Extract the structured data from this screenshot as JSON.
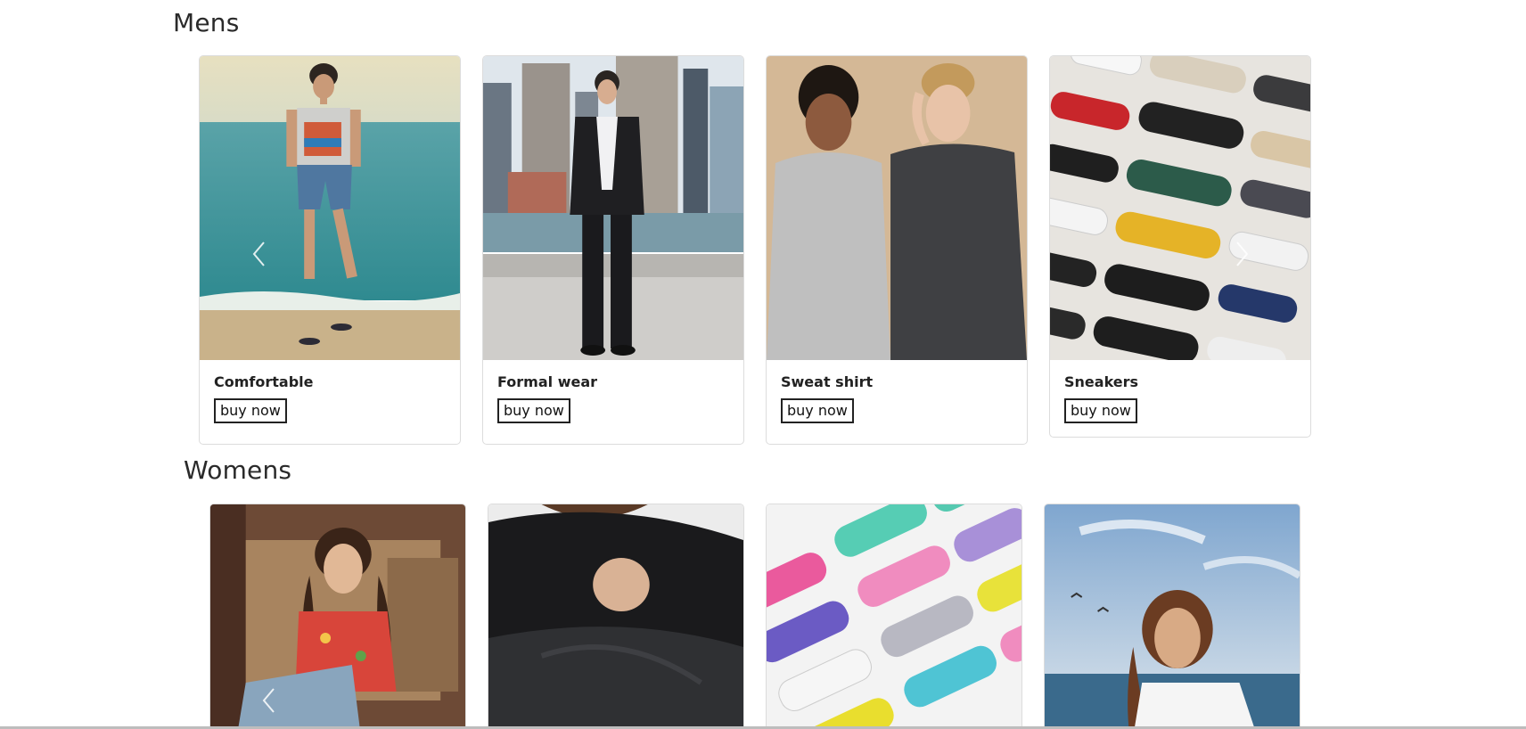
{
  "sections": {
    "mens": {
      "title": "Mens",
      "products": [
        {
          "name": "Comfortable",
          "button": "buy now"
        },
        {
          "name": "Formal wear",
          "button": "buy now"
        },
        {
          "name": "Sweat shirt",
          "button": "buy now"
        },
        {
          "name": "Sneakers",
          "button": "buy now"
        }
      ]
    },
    "womens": {
      "title": "Womens"
    }
  },
  "icons": {
    "prev": "chevron-left-icon",
    "next": "chevron-right-icon"
  }
}
